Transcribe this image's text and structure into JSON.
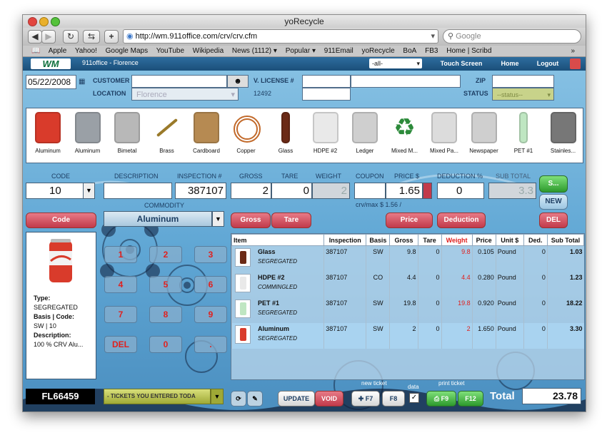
{
  "window": {
    "title": "yoRecycle"
  },
  "toolbar": {
    "url": "http://wm.911office.com/crv/crv.cfm",
    "search_placeholder": "Google"
  },
  "bookmarks": [
    "Apple",
    "Yahoo!",
    "Google Maps",
    "YouTube",
    "Wikipedia",
    "News (1112) ▾",
    "Popular ▾",
    "911Email",
    "yoRecycle",
    "BoA",
    "FB3",
    "Home | Scribd"
  ],
  "header": {
    "logo": "WM",
    "office": "911office - Florence",
    "filter": "-all-",
    "nav": [
      "Touch Screen",
      "Home",
      "Logout"
    ]
  },
  "form": {
    "date": "05/22/2008",
    "customer_label": "CUSTOMER",
    "location_label": "LOCATION",
    "location_value": "Florence",
    "vlicense_label": "V. LICENSE #",
    "license_number": "12492",
    "zip_label": "ZIP",
    "status_label": "STATUS",
    "status_value": "--status--"
  },
  "products": [
    {
      "label": "Aluminum",
      "icon": "soda-can-icon",
      "color": "#d93b2b"
    },
    {
      "label": "Aluminum",
      "icon": "crushed-cans-icon",
      "color": "#9aa0a6"
    },
    {
      "label": "Bimetal",
      "icon": "bimetal-cans-icon",
      "color": "#b8b8b8"
    },
    {
      "label": "Brass",
      "icon": "brass-rod-icon",
      "color": "#9a7a2a"
    },
    {
      "label": "Cardboard",
      "icon": "cardboard-box-icon",
      "color": "#b68a52"
    },
    {
      "label": "Copper",
      "icon": "copper-coil-icon",
      "color": "#c26a2b"
    },
    {
      "label": "Glass",
      "icon": "glass-bottle-icon",
      "color": "#6b2a16"
    },
    {
      "label": "HDPE #2",
      "icon": "milk-jug-icon",
      "color": "#e9e9e9"
    },
    {
      "label": "Ledger",
      "icon": "paper-stack-icon",
      "color": "#cfcfcf"
    },
    {
      "label": "Mixed M...",
      "icon": "recycle-icon",
      "color": "#2c8a3a"
    },
    {
      "label": "Mixed Pa...",
      "icon": "mixed-paper-bag-icon",
      "color": "#dcdcdc"
    },
    {
      "label": "Newspaper",
      "icon": "newspaper-icon",
      "color": "#cfcfcf"
    },
    {
      "label": "PET #1",
      "icon": "plastic-bottle-icon",
      "color": "#bfe6c2"
    },
    {
      "label": "Stainles...",
      "icon": "pipe-fittings-icon",
      "color": "#777"
    }
  ],
  "entry": {
    "code_label": "CODE",
    "code_value": "10",
    "description_label": "DESCRIPTION",
    "description_value": "",
    "inspection_label": "INSPECTION #",
    "inspection_value": "387107",
    "gross_label": "GROSS",
    "gross_value": "2",
    "tare_label": "TARE",
    "tare_value": "0",
    "weight_label": "WEIGHT",
    "weight_value": "2",
    "coupon_label": "COUPON",
    "coupon_value": "",
    "price_label": "PRICE $",
    "price_value": "1.65",
    "deduction_label": "DEDUCTION %",
    "deduction_value": "0",
    "subtotal_label": "SUB TOTAL",
    "subtotal_value": "3.3",
    "commodity_label": "COMMODITY",
    "commodity_value": "Aluminum",
    "crv_text": "crv/max $  1.56  /"
  },
  "buttons": {
    "code": "Code",
    "gross": "Gross",
    "tare": "Tare",
    "price": "Price",
    "deduction": "Deduction",
    "save": "S...",
    "new": "NEW",
    "del": "DEL"
  },
  "keypad": [
    "1",
    "2",
    "3",
    "4",
    "5",
    "6",
    "7",
    "8",
    "9",
    "DEL",
    "0",
    "."
  ],
  "detail": {
    "type_label": "Type:",
    "type_value": "SEGREGATED",
    "basis_label": "Basis | Code:",
    "basis_value": "SW | 10",
    "desc_label": "Description:",
    "desc_value": "100 % CRV Alu..."
  },
  "grid": {
    "headers": [
      "Item",
      "Inspection",
      "Basis",
      "Gross",
      "Tare",
      "Weight",
      "Price",
      "Unit $",
      "Ded.",
      "Sub Total"
    ],
    "rows": [
      {
        "item": "Glass",
        "sub": "SEGREGATED",
        "inspection": "387107",
        "basis": "SW",
        "gross": "9.8",
        "tare": "0",
        "weight": "9.8",
        "price": "0.105",
        "unit": "Pound",
        "ded": "0",
        "subtotal": "1.03",
        "icon": "glass-bottle-icon"
      },
      {
        "item": "HDPE #2",
        "sub": "COMMINGLED",
        "inspection": "387107",
        "basis": "CO",
        "gross": "4.4",
        "tare": "0",
        "weight": "4.4",
        "price": "0.280",
        "unit": "Pound",
        "ded": "0",
        "subtotal": "1.23",
        "icon": "milk-jug-icon"
      },
      {
        "item": "PET #1",
        "sub": "SEGREGATED",
        "inspection": "387107",
        "basis": "SW",
        "gross": "19.8",
        "tare": "0",
        "weight": "19.8",
        "price": "0.920",
        "unit": "Pound",
        "ded": "0",
        "subtotal": "18.22",
        "icon": "plastic-bottle-icon"
      },
      {
        "item": "Aluminum",
        "sub": "SEGREGATED",
        "inspection": "387107",
        "basis": "SW",
        "gross": "2",
        "tare": "0",
        "weight": "2",
        "price": "1.650",
        "unit": "Pound",
        "ded": "0",
        "subtotal": "3.30",
        "icon": "soda-can-icon",
        "selected": true
      }
    ]
  },
  "footer": {
    "ticket_id": "FL66459",
    "tickets_dropdown": "- TICKETS YOU ENTERED TODA",
    "update": "UPDATE",
    "void": "VOID",
    "new_ticket_label": "new ticket",
    "f7": "F7",
    "f8": "F8",
    "data_label": "data",
    "print_ticket_label": "print ticket",
    "f9": "F9",
    "f12": "F12",
    "total_label": "Total",
    "total_value": "23.78"
  },
  "colors": {
    "accent_blue": "#1b4f7a",
    "red_button": "#c23a4b",
    "green_button": "#2d9a2c",
    "weight_red": "#e0201e"
  }
}
